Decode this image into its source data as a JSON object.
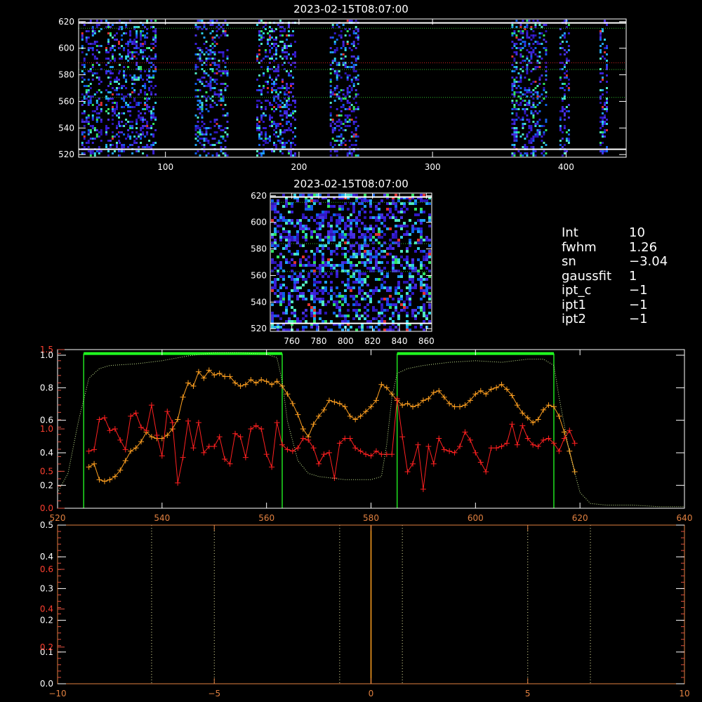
{
  "chart_data": [
    {
      "type": "heatmap",
      "title": "2023-02-15T08:07:00",
      "xlim": [
        35,
        445
      ],
      "ylim": [
        518,
        622
      ],
      "xticks": [
        100,
        200,
        300,
        400
      ],
      "yticks": [
        520,
        540,
        560,
        580,
        600,
        620
      ],
      "stripes_x": [
        [
          37,
          52
        ],
        [
          55,
          65
        ],
        [
          65,
          92
        ],
        [
          122,
          146
        ],
        [
          168,
          197
        ],
        [
          223,
          244
        ],
        [
          359,
          385
        ],
        [
          395,
          402
        ],
        [
          425,
          430
        ]
      ],
      "white_lines_y": [
        524,
        619
      ],
      "green_lines_y": [
        563,
        584,
        615
      ],
      "red_line_y": 589,
      "colors": {
        "white_line": "#ffffff",
        "green_line": "#2fbf2f",
        "red_line": "#d02020"
      }
    },
    {
      "type": "heatmap",
      "title": "2023-02-15T08:07:00",
      "xlim": [
        744,
        864
      ],
      "ylim": [
        518,
        622
      ],
      "xticks": [
        760,
        780,
        800,
        820,
        840,
        860
      ],
      "yticks": [
        520,
        540,
        560,
        580,
        600,
        620
      ],
      "white_lines_y": [
        524,
        619
      ],
      "green_lines_y": [
        563,
        584,
        615
      ]
    },
    {
      "type": "line",
      "xlim": [
        520,
        640
      ],
      "xticks": [
        520,
        540,
        560,
        580,
        600,
        620,
        640
      ],
      "left_axis_white_ticks": [
        "0.2",
        "0.4",
        "0.6",
        "0.8",
        "1.0"
      ],
      "left_axis_red_ticks": [
        "0.0",
        "0.5",
        "1.0",
        "1.5"
      ],
      "left_axis_red_tick_fracs": [
        0.0,
        0.233,
        0.5,
        1.0
      ],
      "left_axis_white_tick_fracs": [
        0.18,
        0.385,
        0.59,
        0.795,
        1.0
      ],
      "white_tick_shift": 0.0,
      "green_boxes": [
        [
          525,
          563
        ],
        [
          585,
          615
        ]
      ],
      "green_box_top_frac": 0.975,
      "series": [
        {
          "color": "#ffa020",
          "x": [
            526,
            527,
            528,
            529,
            530,
            531,
            532,
            533,
            534,
            535,
            536,
            537,
            538,
            539,
            540,
            541,
            542,
            543,
            544,
            545,
            546,
            547,
            548,
            549,
            550,
            551,
            552,
            553,
            554,
            555,
            556,
            557,
            558,
            559,
            560,
            561,
            562,
            563,
            564,
            565,
            566,
            567,
            568,
            569,
            570,
            571,
            572,
            573,
            574,
            575,
            576,
            577,
            578,
            579,
            580,
            581,
            582,
            583,
            584,
            585,
            586,
            587,
            588,
            589,
            590,
            591,
            592,
            593,
            594,
            595,
            596,
            597,
            598,
            599,
            600,
            601,
            602,
            603,
            604,
            605,
            606,
            607,
            608,
            609,
            610,
            611,
            612,
            613,
            614,
            615,
            616,
            617,
            618,
            619
          ],
          "y": [
            0.26,
            0.28,
            0.18,
            0.17,
            0.18,
            0.2,
            0.24,
            0.3,
            0.36,
            0.38,
            0.42,
            0.48,
            0.45,
            0.44,
            0.44,
            0.46,
            0.5,
            0.56,
            0.7,
            0.79,
            0.77,
            0.86,
            0.82,
            0.87,
            0.84,
            0.85,
            0.83,
            0.83,
            0.79,
            0.77,
            0.78,
            0.81,
            0.79,
            0.81,
            0.8,
            0.78,
            0.8,
            0.77,
            0.72,
            0.66,
            0.59,
            0.5,
            0.45,
            0.53,
            0.58,
            0.62,
            0.68,
            0.67,
            0.66,
            0.64,
            0.58,
            0.56,
            0.58,
            0.61,
            0.64,
            0.68,
            0.78,
            0.76,
            0.72,
            0.68,
            0.65,
            0.66,
            0.64,
            0.65,
            0.68,
            0.69,
            0.73,
            0.74,
            0.7,
            0.66,
            0.64,
            0.64,
            0.65,
            0.68,
            0.72,
            0.74,
            0.72,
            0.75,
            0.76,
            0.78,
            0.75,
            0.71,
            0.65,
            0.6,
            0.57,
            0.54,
            0.56,
            0.62,
            0.65,
            0.64,
            0.58,
            0.48,
            0.36,
            0.23
          ]
        },
        {
          "color": "#ff2020",
          "x": [
            526,
            527,
            528,
            529,
            530,
            531,
            532,
            533,
            534,
            535,
            536,
            537,
            538,
            539,
            540,
            541,
            542,
            543,
            544,
            545,
            546,
            547,
            548,
            549,
            550,
            551,
            552,
            553,
            554,
            555,
            556,
            557,
            558,
            559,
            560,
            561,
            562,
            563,
            564,
            565,
            566,
            567,
            568,
            569,
            570,
            571,
            572,
            573,
            574,
            575,
            576,
            577,
            578,
            579,
            580,
            581,
            582,
            583,
            584,
            585,
            586,
            587,
            588,
            589,
            590,
            591,
            592,
            593,
            594,
            595,
            596,
            597,
            598,
            599,
            600,
            601,
            602,
            603,
            604,
            605,
            606,
            607,
            608,
            609,
            610,
            611,
            612,
            613,
            614,
            615,
            616,
            617,
            618,
            619
          ],
          "y": [
            0.36,
            0.37,
            0.56,
            0.57,
            0.49,
            0.5,
            0.43,
            0.37,
            0.58,
            0.6,
            0.51,
            0.49,
            0.65,
            0.46,
            0.33,
            0.61,
            0.54,
            0.16,
            0.32,
            0.55,
            0.38,
            0.54,
            0.35,
            0.39,
            0.39,
            0.45,
            0.31,
            0.28,
            0.47,
            0.45,
            0.32,
            0.5,
            0.52,
            0.5,
            0.34,
            0.26,
            0.54,
            0.4,
            0.37,
            0.36,
            0.38,
            0.44,
            0.43,
            0.38,
            0.28,
            0.34,
            0.35,
            0.19,
            0.41,
            0.44,
            0.44,
            0.38,
            0.36,
            0.34,
            0.33,
            0.36,
            0.34,
            0.34,
            0.34,
            0.69,
            0.45,
            0.23,
            0.28,
            0.4,
            0.12,
            0.39,
            0.28,
            0.44,
            0.37,
            0.36,
            0.35,
            0.39,
            0.48,
            0.43,
            0.35,
            0.29,
            0.23,
            0.38,
            0.38,
            0.39,
            0.41,
            0.53,
            0.4,
            0.52,
            0.44,
            0.4,
            0.39,
            0.43,
            0.44,
            0.41,
            0.36,
            0.44,
            0.49,
            0.41
          ]
        },
        {
          "color": "#c8e890",
          "x": [
            520,
            522,
            524,
            526,
            528,
            530,
            535,
            540,
            545,
            550,
            555,
            560,
            562,
            563,
            564,
            566,
            568,
            570,
            575,
            580,
            582,
            583,
            584,
            585,
            587,
            590,
            595,
            600,
            605,
            610,
            613,
            615,
            616,
            618,
            620,
            622,
            625,
            630,
            635,
            640
          ],
          "y": [
            0.1,
            0.22,
            0.55,
            0.82,
            0.88,
            0.9,
            0.91,
            0.93,
            0.96,
            0.98,
            0.98,
            0.97,
            0.95,
            0.8,
            0.55,
            0.3,
            0.22,
            0.2,
            0.18,
            0.18,
            0.2,
            0.4,
            0.7,
            0.85,
            0.88,
            0.9,
            0.92,
            0.93,
            0.92,
            0.94,
            0.94,
            0.9,
            0.7,
            0.35,
            0.1,
            0.03,
            0.02,
            0.02,
            0.01,
            0.01
          ]
        }
      ]
    },
    {
      "type": "line",
      "xlim": [
        -10,
        10
      ],
      "xticks": [
        "−10",
        "−5",
        "0",
        "5",
        "10"
      ],
      "xtick_vals": [
        -10,
        -5,
        0,
        5,
        10
      ],
      "left_axis_white_ticks": [
        "0.0",
        "0.1",
        "0.2",
        "0.3",
        "0.4",
        "0.5"
      ],
      "left_axis_white_tick_fracs": [
        0.0,
        0.2,
        0.4,
        0.6,
        0.8,
        1.0
      ],
      "left_axis_red_ticks": [
        "0.2",
        "0.4",
        "0.6"
      ],
      "left_axis_red_tick_fracs": [
        0.24,
        0.48,
        0.73
      ],
      "dotted_verticals_x": [
        -7,
        -5,
        -1,
        1,
        5,
        7
      ],
      "orange_vertical_x": 0
    }
  ],
  "info_panel": [
    {
      "key": "Int",
      "value": "10"
    },
    {
      "key": "fwhm",
      "value": "1.26"
    },
    {
      "key": "sn",
      "value": "−3.04"
    },
    {
      "key": "gaussfit",
      "value": "1"
    },
    {
      "key": "ipt_c",
      "value": "−1"
    },
    {
      "key": "ipt1",
      "value": "−1"
    },
    {
      "key": "ipt2",
      "value": "−1"
    }
  ]
}
